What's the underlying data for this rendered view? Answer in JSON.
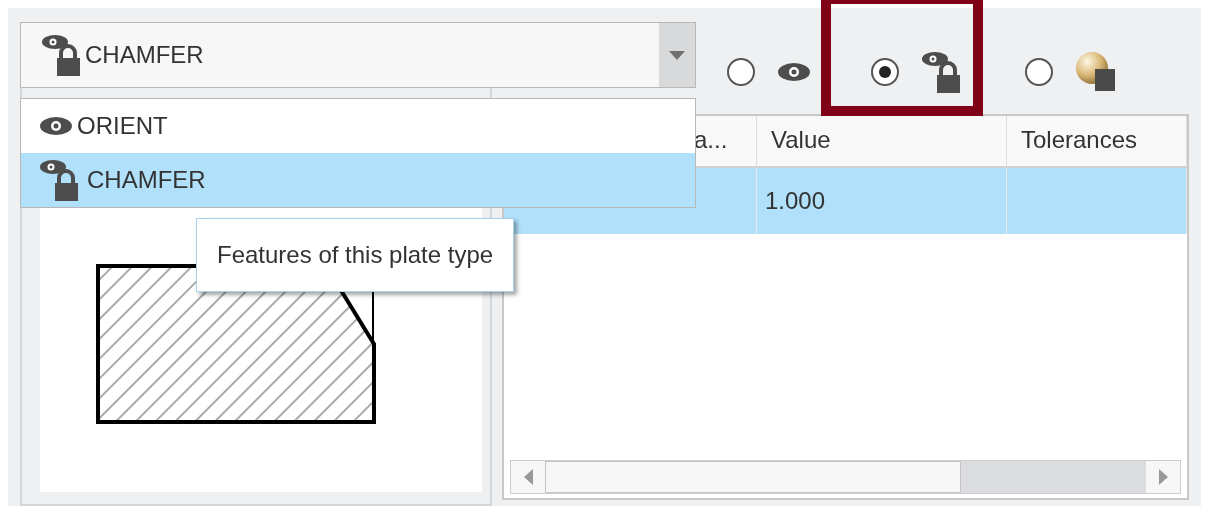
{
  "combo": {
    "value": "CHAMFER",
    "kind": "eye-lock",
    "expanded": true
  },
  "dropdown": {
    "items": [
      {
        "label": "ORIENT",
        "kind": "eye",
        "selected": false
      },
      {
        "label": "CHAMFER",
        "kind": "eye-lock",
        "selected": true
      }
    ]
  },
  "preview": {
    "tooltip": "Features of this plate type"
  },
  "display_options": [
    {
      "kind": "eye",
      "selected": false,
      "highlighted": false
    },
    {
      "kind": "eye-lock",
      "selected": true,
      "highlighted": true
    },
    {
      "kind": "shaded",
      "selected": false,
      "highlighted": false
    }
  ],
  "table": {
    "columns": [
      "a...",
      "Value",
      "Tolerances"
    ],
    "rows": [
      {
        "value": "1.000",
        "selected": true
      }
    ]
  }
}
